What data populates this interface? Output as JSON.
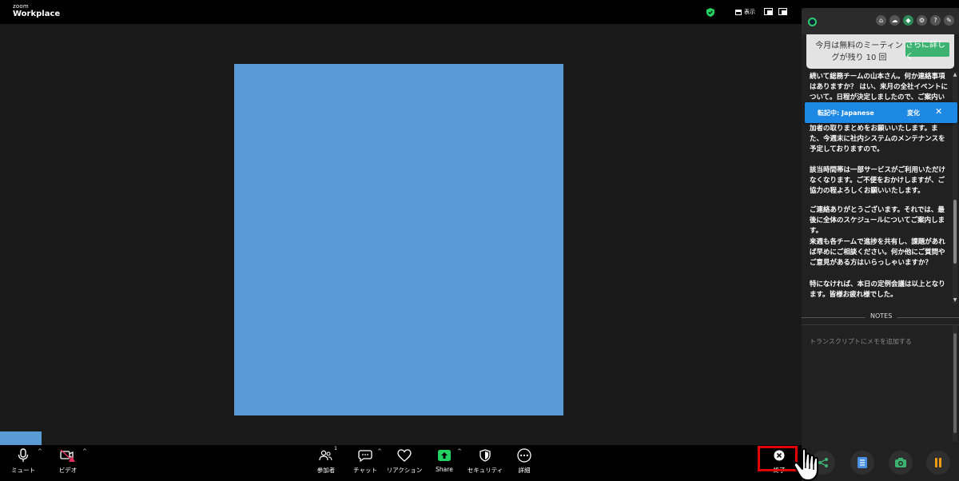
{
  "app": {
    "brand_top": "zoom",
    "brand_main": "Workplace",
    "view_label": "表示",
    "accent": "#0e72ed",
    "share_color": "#5b9bd5"
  },
  "toolbar": {
    "mute_label": "ミュート",
    "video_label": "ビデオ",
    "participants_label": "参加者",
    "participants_count": "1",
    "chat_label": "チャット",
    "reactions_label": "リアクション",
    "share_label": "Share",
    "security_label": "セキュリティ",
    "more_label": "詳細",
    "end_label": "終了",
    "end_highlight_color": "#e00000"
  },
  "panel": {
    "promo_text": "今月は無料のミーティングが残り 10 回",
    "promo_button": "さらに詳しく",
    "banner_text": "転記中: Japanese",
    "banner_change": "変化",
    "banner_close": "✕",
    "transcript": [
      "続いて総務チームの山本さん。何か連絡事項はありますか？ はい、来月の全社イベントについて。日程が決定しましたので、ご案内いたします。",
      "加者の取りまとめをお願いいたします。また、今週末に社内システムのメンテナンスを予定しておりますので。",
      "該当時間帯は一部サービスがご利用いただけなくなります。ご不便をおかけしますが、ご協力の程よろしくお願いいたします。",
      "ご連絡ありがとうございます。それでは、最後に全体のスケジュールについてご案内します。",
      "来週も各チームで進捗を共有し、課題があれば早めにご相談ください。何か他にご質問やご意見がある方はいらっしゃいますか？",
      "特になければ、本日の定例会議は以上となります。皆様お疲れ様でした。"
    ],
    "notes_heading": "NOTES",
    "notes_placeholder": "トランスクリプトにメモを追加する",
    "brand_green": "#3cb371",
    "banner_blue": "#1e88e5"
  }
}
